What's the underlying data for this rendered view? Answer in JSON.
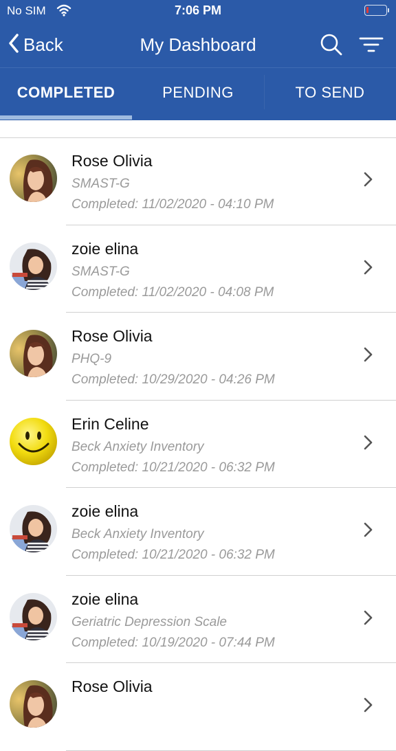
{
  "status_bar": {
    "carrier": "No SIM",
    "time": "7:06 PM",
    "battery_level": 0.12
  },
  "nav": {
    "back_label": "Back",
    "title": "My Dashboard"
  },
  "tabs": [
    {
      "label": "COMPLETED",
      "active": true
    },
    {
      "label": "PENDING",
      "active": false
    },
    {
      "label": "TO SEND",
      "active": false
    }
  ],
  "colors": {
    "brand": "#2b5aa8",
    "indicator": "#9fbbe0",
    "muted_text": "#9a9a9a",
    "battery_low": "#e53935"
  },
  "items": [
    {
      "name": "Rose Olivia",
      "test": "SMAST-G",
      "completed": "Completed: 11/02/2020 - 04:10 PM",
      "avatar": "woman-photo"
    },
    {
      "name": "zoie elina",
      "test": "SMAST-G",
      "completed": "Completed: 11/02/2020 - 04:08 PM",
      "avatar": "girl-photo"
    },
    {
      "name": "Rose Olivia",
      "test": "PHQ-9",
      "completed": "Completed: 10/29/2020 - 04:26 PM",
      "avatar": "woman-photo"
    },
    {
      "name": "Erin Celine",
      "test": "Beck Anxiety Inventory",
      "completed": "Completed: 10/21/2020 - 06:32 PM",
      "avatar": "smiley-photo"
    },
    {
      "name": "zoie elina",
      "test": "Beck Anxiety Inventory",
      "completed": "Completed: 10/21/2020 - 06:32 PM",
      "avatar": "girl-photo"
    },
    {
      "name": "zoie elina",
      "test": "Geriatric Depression Scale",
      "completed": "Completed: 10/19/2020 - 07:44 PM",
      "avatar": "girl-photo"
    },
    {
      "name": "Rose Olivia",
      "test": "",
      "completed": "",
      "avatar": "woman-photo"
    }
  ]
}
